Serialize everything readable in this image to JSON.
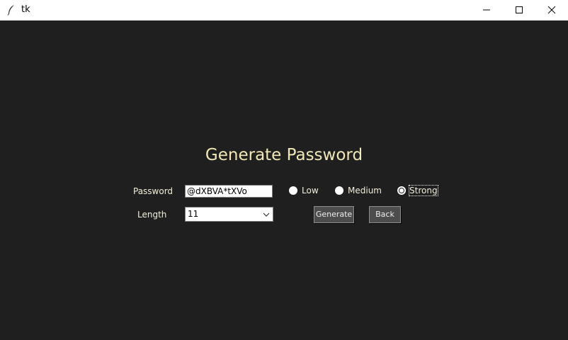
{
  "window": {
    "title": "tk",
    "icon": "feather-icon"
  },
  "controls": {
    "minimize_icon": "minimize-icon",
    "maximize_icon": "maximize-icon",
    "close_icon": "close-icon"
  },
  "form": {
    "heading": "Generate Password",
    "password_label": "Password",
    "password_value": "@dXBVA*tXVo",
    "length_label": "Length",
    "length_value": "11",
    "strength_options": [
      {
        "label": "Low",
        "selected": false
      },
      {
        "label": "Medium",
        "selected": false
      },
      {
        "label": "Strong",
        "selected": true
      }
    ],
    "generate_label": "Generate",
    "back_label": "Back"
  },
  "colors": {
    "background": "#1f1f1f",
    "heading": "#f2e7b6",
    "label": "#f3efd8",
    "button": "#4d4d4d"
  }
}
